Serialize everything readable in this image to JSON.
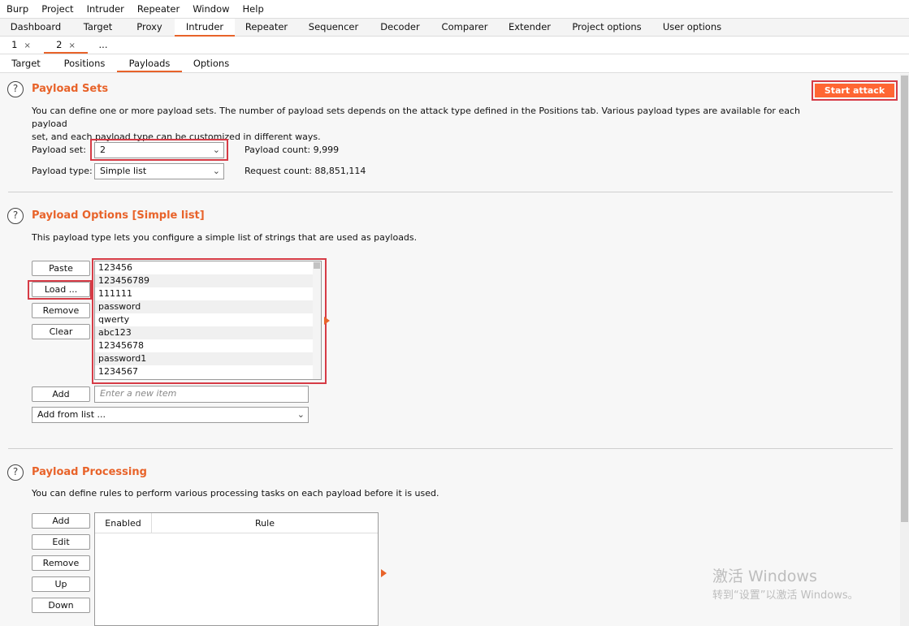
{
  "menu": [
    "Burp",
    "Project",
    "Intruder",
    "Repeater",
    "Window",
    "Help"
  ],
  "main_tabs": [
    "Dashboard",
    "Target",
    "Proxy",
    "Intruder",
    "Repeater",
    "Sequencer",
    "Decoder",
    "Comparer",
    "Extender",
    "Project options",
    "User options"
  ],
  "sub_tabs": [
    {
      "label": "1",
      "close": "×"
    },
    {
      "label": "2",
      "close": "×"
    },
    {
      "label": "...",
      "close": ""
    }
  ],
  "intruder_tabs": [
    "Target",
    "Positions",
    "Payloads",
    "Options"
  ],
  "payload_sets": {
    "title": "Payload Sets",
    "desc_line1": "You can define one or more payload sets. The number of payload sets depends on the attack type defined in the Positions tab. Various payload types are available for each payload",
    "desc_line2": "set, and each payload type can be customized in different ways.",
    "set_label": "Payload set:",
    "set_value": "2",
    "type_label": "Payload type:",
    "type_value": "Simple list",
    "count_label": "Payload count:",
    "count_value": "9,999",
    "request_label": "Request count:",
    "request_value": "88,851,114",
    "start_attack": "Start attack"
  },
  "payload_options": {
    "title": "Payload Options [Simple list]",
    "desc": "This payload type lets you configure a simple list of strings that are used as payloads.",
    "buttons": [
      "Paste",
      "Load ...",
      "Remove",
      "Clear"
    ],
    "items": [
      "123456",
      "123456789",
      "111111",
      "password",
      "qwerty",
      "abc123",
      "12345678",
      "password1",
      "1234567"
    ],
    "add_button": "Add",
    "add_placeholder": "Enter a new item",
    "add_from_list": "Add from list ..."
  },
  "payload_processing": {
    "title": "Payload Processing",
    "desc": "You can define rules to perform various processing tasks on each payload before it is used.",
    "buttons": [
      "Add",
      "Edit",
      "Remove",
      "Up",
      "Down"
    ],
    "col_enabled": "Enabled",
    "col_rule": "Rule"
  },
  "watermark": {
    "line1": "激活 Windows",
    "line2": "转到“设置”以激活 Windows。"
  },
  "colors": {
    "accent": "#e8632a",
    "start_button": "#ff6633",
    "highlight": "#d63b46"
  },
  "icons": {
    "help": "help-circle-icon",
    "dropdown": "chevron-down-icon",
    "arrow": "triangle-right-icon"
  }
}
